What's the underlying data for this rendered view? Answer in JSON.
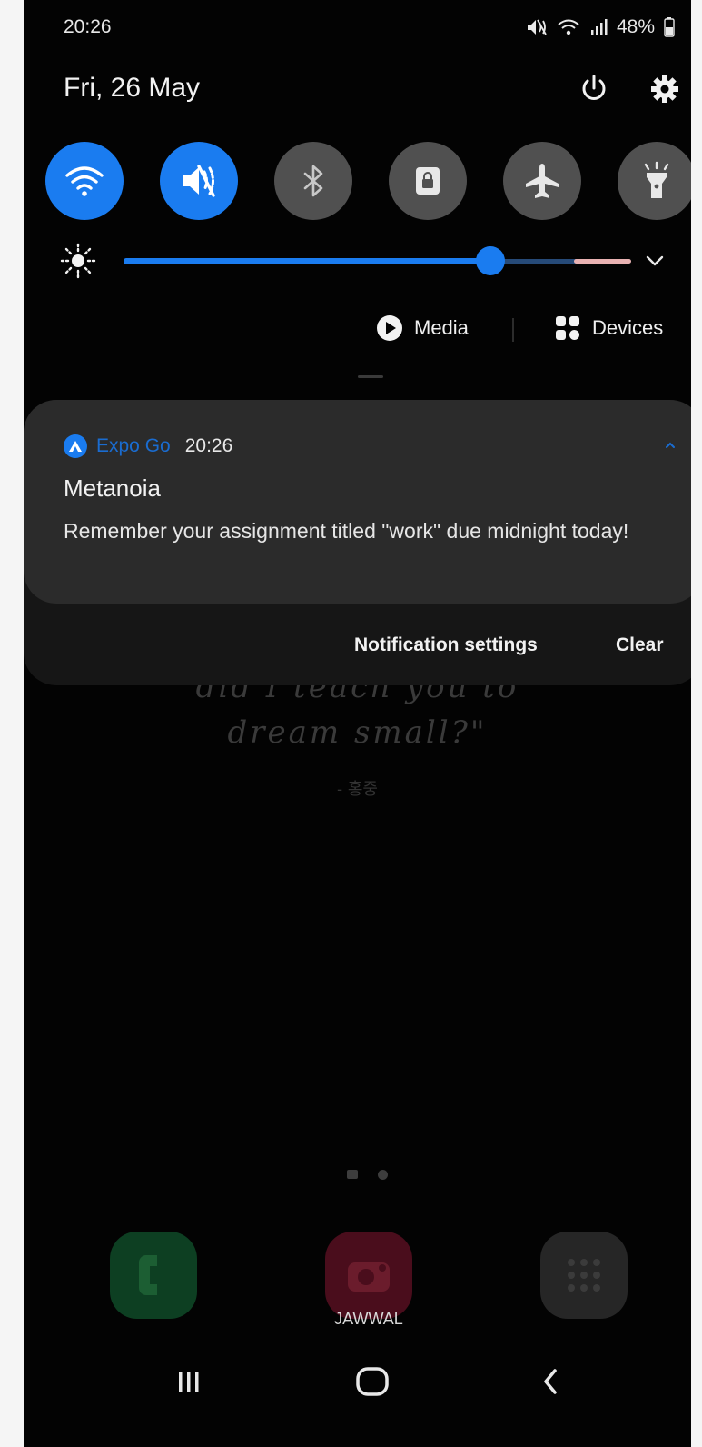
{
  "status_bar": {
    "time": "20:26",
    "battery_percent": "48%",
    "icons": [
      "mute-icon",
      "wifi-icon",
      "signal-icon",
      "battery-icon"
    ]
  },
  "header": {
    "date": "Fri, 26 May",
    "power_icon": "power-icon",
    "settings_icon": "gear-icon"
  },
  "quick_settings": [
    {
      "name": "wifi",
      "icon": "wifi-icon",
      "active": true
    },
    {
      "name": "mute",
      "icon": "mute-icon",
      "active": true
    },
    {
      "name": "bluetooth",
      "icon": "bluetooth-icon",
      "active": false
    },
    {
      "name": "portrait-lock",
      "icon": "lock-icon",
      "active": false
    },
    {
      "name": "airplane",
      "icon": "airplane-icon",
      "active": false
    },
    {
      "name": "flashlight",
      "icon": "flashlight-icon",
      "active": false
    }
  ],
  "brightness": {
    "level": 0.77
  },
  "media_output": {
    "media_label": "Media",
    "devices_label": "Devices"
  },
  "notification": {
    "app_name": "Expo Go",
    "time": "20:26",
    "title": "Metanoia",
    "body": "Remember your assignment titled \"work\" due midnight today!"
  },
  "notification_actions": {
    "settings_label": "Notification settings",
    "clear_label": "Clear"
  },
  "wallpaper": {
    "line1": "did I teach you to",
    "line2": "dream small?\"",
    "author": "- 홍중"
  },
  "dock": {
    "apps": [
      {
        "name": "phone",
        "icon": "phone-icon"
      },
      {
        "name": "camera",
        "icon": "camera-icon"
      },
      {
        "name": "apps",
        "icon": "apps-grid-icon"
      }
    ],
    "camera_label": "JAWWAL"
  },
  "navigation": {
    "buttons": [
      "recents-icon",
      "home-icon",
      "back-icon"
    ]
  },
  "colors": {
    "accent": "#1a7cf0",
    "panel": "#030303",
    "card": "#2b2b2b"
  }
}
